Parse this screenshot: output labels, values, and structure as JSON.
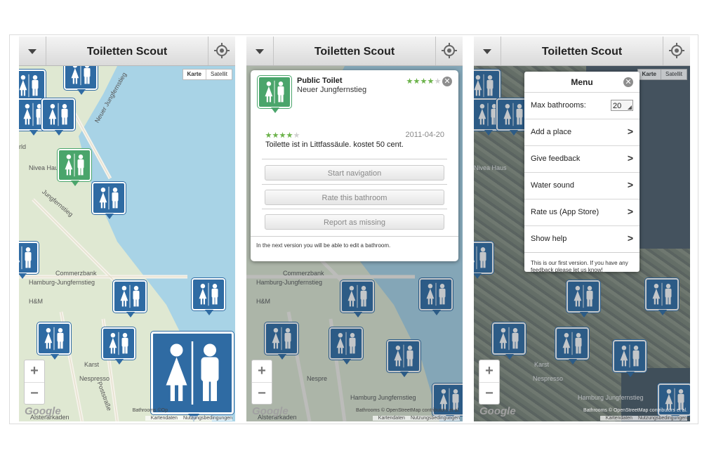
{
  "app": {
    "title": "Toiletten Scout"
  },
  "map": {
    "type_controls": [
      "Karte",
      "Satellit"
    ],
    "zoom_in": "+",
    "zoom_out": "−",
    "google": "Google",
    "attribution": "Bathrooms © OpenStreetMap contributors et al.",
    "attribution_short": "Bathrooms ©Op",
    "terms": [
      "Kartendaten",
      "Nutzungsbedingungen"
    ],
    "labels": [
      "Neuer Jungfernstieg",
      "Nivea Haus",
      "Jungfernstieg",
      "Commerzbank",
      "Hamburg-Jungfernstieg",
      "H&M",
      "Karst",
      "Nespresso",
      "Poststraße",
      "Alsterarkaden",
      "Hamburg Jungfernstieg",
      "Karat",
      "Nespre",
      "Karst"
    ]
  },
  "detail": {
    "name": "Public Toilet",
    "address": "Neuer Jungfernstieg",
    "rating": 4,
    "review_rating": 4,
    "review_date": "2011-04-20",
    "review_text": "Toilette ist in Littfassäule. kostet 50 cent.",
    "buttons": [
      "Start navigation",
      "Rate this bathroom",
      "Report as missing"
    ],
    "note": "In the next version you will be able to edit a bathroom."
  },
  "menu": {
    "title": "Menu",
    "max_label": "Max bathrooms:",
    "max_value": "20",
    "items": [
      "Add a place",
      "Give feedback",
      "Water sound",
      "Rate us (App Store)",
      "Show help"
    ],
    "note": "This is our first version. If you have any feedback please let us know!"
  },
  "colors": {
    "pin": "#2f6ba3",
    "pin_selected": "#4aa56b",
    "water": "#a8d3e6"
  }
}
